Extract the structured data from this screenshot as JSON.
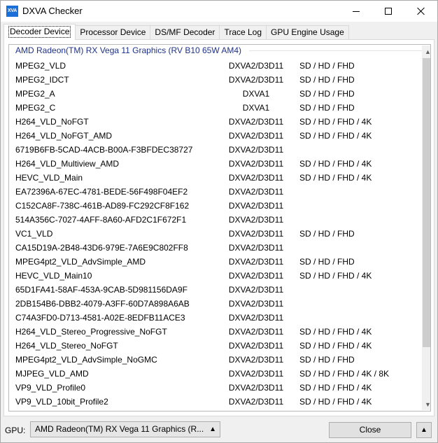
{
  "window": {
    "app_icon_text": "XVA",
    "title": "DXVA Checker"
  },
  "tabs": [
    {
      "label": "Decoder Device",
      "active": true
    },
    {
      "label": "Processor Device",
      "active": false
    },
    {
      "label": "DS/MF Decoder",
      "active": false
    },
    {
      "label": "Trace Log",
      "active": false
    },
    {
      "label": "GPU Engine Usage",
      "active": false
    }
  ],
  "decoder_list": {
    "group_header": "AMD Radeon(TM) RX Vega 11 Graphics (RV B10 65W AM4)",
    "rows": [
      {
        "name": "MPEG2_VLD",
        "api": "DXVA2/D3D11",
        "res": "SD / HD / FHD"
      },
      {
        "name": "MPEG2_IDCT",
        "api": "DXVA2/D3D11",
        "res": "SD / HD / FHD"
      },
      {
        "name": "MPEG2_A",
        "api": "DXVA1",
        "res": "SD / HD / FHD"
      },
      {
        "name": "MPEG2_C",
        "api": "DXVA1",
        "res": "SD / HD / FHD"
      },
      {
        "name": "H264_VLD_NoFGT",
        "api": "DXVA2/D3D11",
        "res": "SD / HD / FHD / 4K"
      },
      {
        "name": "H264_VLD_NoFGT_AMD",
        "api": "DXVA2/D3D11",
        "res": "SD / HD / FHD / 4K"
      },
      {
        "name": "6719B6FB-5CAD-4ACB-B00A-F3BFDEC38727",
        "api": "DXVA2/D3D11",
        "res": ""
      },
      {
        "name": "H264_VLD_Multiview_AMD",
        "api": "DXVA2/D3D11",
        "res": "SD / HD / FHD / 4K"
      },
      {
        "name": "HEVC_VLD_Main",
        "api": "DXVA2/D3D11",
        "res": "SD / HD / FHD / 4K"
      },
      {
        "name": "EA72396A-67EC-4781-BEDE-56F498F04EF2",
        "api": "DXVA2/D3D11",
        "res": ""
      },
      {
        "name": "C152CA8F-738C-461B-AD89-FC292CF8F162",
        "api": "DXVA2/D3D11",
        "res": ""
      },
      {
        "name": "514A356C-7027-4AFF-8A60-AFD2C1F672F1",
        "api": "DXVA2/D3D11",
        "res": ""
      },
      {
        "name": "VC1_VLD",
        "api": "DXVA2/D3D11",
        "res": "SD / HD / FHD"
      },
      {
        "name": "CA15D19A-2B48-43D6-979E-7A6E9C802FF8",
        "api": "DXVA2/D3D11",
        "res": ""
      },
      {
        "name": "MPEG4pt2_VLD_AdvSimple_AMD",
        "api": "DXVA2/D3D11",
        "res": "SD / HD / FHD"
      },
      {
        "name": "HEVC_VLD_Main10",
        "api": "DXVA2/D3D11",
        "res": "SD / HD / FHD / 4K"
      },
      {
        "name": "65D1FA41-58AF-453A-9CAB-5D981156DA9F",
        "api": "DXVA2/D3D11",
        "res": ""
      },
      {
        "name": "2DB154B6-DBB2-4079-A3FF-60D7A898A6AB",
        "api": "DXVA2/D3D11",
        "res": ""
      },
      {
        "name": "C74A3FD0-D713-4581-A02E-8EDFB11ACE3",
        "api": "DXVA2/D3D11",
        "res": ""
      },
      {
        "name": "H264_VLD_Stereo_Progressive_NoFGT",
        "api": "DXVA2/D3D11",
        "res": "SD / HD / FHD / 4K"
      },
      {
        "name": "H264_VLD_Stereo_NoFGT",
        "api": "DXVA2/D3D11",
        "res": "SD / HD / FHD / 4K"
      },
      {
        "name": "MPEG4pt2_VLD_AdvSimple_NoGMC",
        "api": "DXVA2/D3D11",
        "res": "SD / HD / FHD"
      },
      {
        "name": "MJPEG_VLD_AMD",
        "api": "DXVA2/D3D11",
        "res": "SD / HD / FHD / 4K / 8K"
      },
      {
        "name": "VP9_VLD_Profile0",
        "api": "DXVA2/D3D11",
        "res": "SD / HD / FHD / 4K"
      },
      {
        "name": "VP9_VLD_10bit_Profile2",
        "api": "DXVA2/D3D11",
        "res": "SD / HD / FHD / 4K"
      }
    ]
  },
  "bottom_bar": {
    "gpu_label": "GPU:",
    "gpu_selected": "AMD Radeon(TM) RX Vega 11 Graphics (R...",
    "close_label": "Close"
  },
  "icons": {
    "app": "app-logo-icon",
    "minimize": "minimize-icon",
    "maximize": "maximize-icon",
    "close": "close-icon",
    "dropdown": "chevron-up-icon",
    "scroll_up": "scroll-up-arrow-icon",
    "scroll_down": "scroll-down-arrow-icon"
  },
  "colors": {
    "app_icon_bg": "#1a6fd8",
    "group_header_text": "#1e3287",
    "window_bg": "#f0f0f0"
  }
}
